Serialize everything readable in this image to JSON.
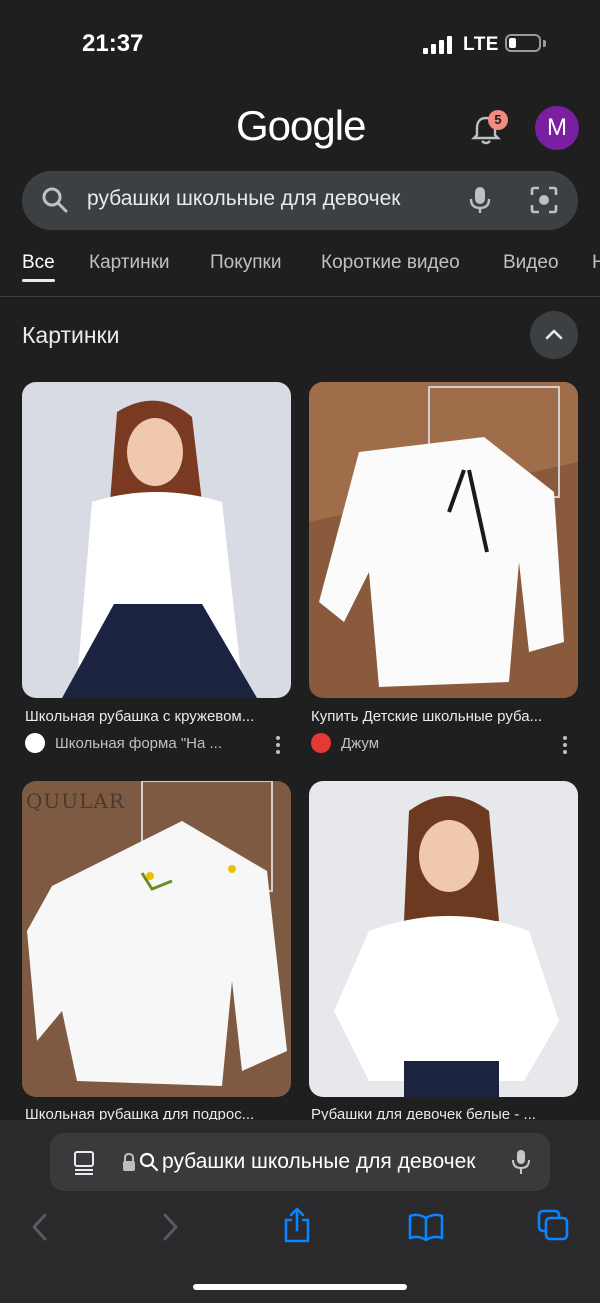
{
  "status": {
    "time": "21:37",
    "network": "LTE"
  },
  "header": {
    "logo": "Google",
    "notification_count": "5",
    "avatar_letter": "M"
  },
  "search": {
    "query": "рубашки школьные для девочек"
  },
  "tabs": [
    "Все",
    "Картинки",
    "Покупки",
    "Короткие видео",
    "Видео",
    "Н"
  ],
  "images_section": {
    "title": "Картинки"
  },
  "results": [
    {
      "caption": "Школьная рубашка с кружевом...",
      "source": "Школьная форма \"На ..."
    },
    {
      "caption": "Купить Детские школьные руба...",
      "source": "Джум"
    },
    {
      "caption": "Школьная рубашка для подрос...",
      "source": ""
    },
    {
      "caption": "Рубашки для девочек белые - ...",
      "source": ""
    }
  ],
  "image_watermark": "QUULAR",
  "browser": {
    "url_text": "рубашки школьные для девочек"
  },
  "colors": {
    "background": "#1f1f1f",
    "search_bg": "#3c4043",
    "avatar": "#7b1fa2",
    "badge": "#f28b82",
    "accent_blue": "#0a84ff"
  }
}
